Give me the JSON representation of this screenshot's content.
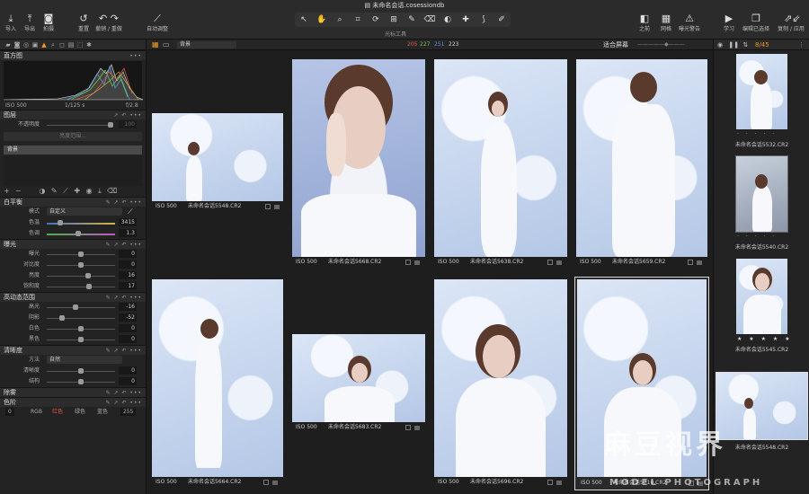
{
  "window": {
    "title": "未命名会话.cosessiondb"
  },
  "toolbar": {
    "import": "导入",
    "export": "导出",
    "capture": "拍摄",
    "reset": "重置",
    "undo_redo": "撤销 / 重做",
    "auto_adjust": "自动调整",
    "cursor_tools": "光标工具",
    "before": "之前",
    "grid": "网格",
    "exposure_warning": "曝光警告",
    "learn": "学习",
    "edit_selected": "编辑已选择",
    "copy_apply": "复制 / 应用"
  },
  "left": {
    "histogram": {
      "title": "直方图",
      "iso": "ISO 500",
      "shutter": "1/125 s",
      "aperture": "f/2.8"
    },
    "layers": {
      "title": "图层",
      "opacity_label": "不透明度",
      "opacity_value": "100",
      "brightness_range": "亮度范围...",
      "layer_name": "背景"
    },
    "white_balance": {
      "title": "白平衡",
      "mode_label": "模式",
      "mode_value": "自定义",
      "temp_label": "色温",
      "temp_value": "3415",
      "tint_label": "色调",
      "tint_value": "1.3"
    },
    "exposure": {
      "title": "曝光",
      "rows": [
        {
          "label": "曝光",
          "value": "0"
        },
        {
          "label": "对比度",
          "value": "0"
        },
        {
          "label": "亮度",
          "value": "16"
        },
        {
          "label": "饱和度",
          "value": "17"
        }
      ]
    },
    "hdr": {
      "title": "高动态范围",
      "rows": [
        {
          "label": "高光",
          "value": "-16"
        },
        {
          "label": "阴影",
          "value": "-52"
        },
        {
          "label": "白色",
          "value": "0"
        },
        {
          "label": "黑色",
          "value": "0"
        }
      ]
    },
    "clarity": {
      "title": "清晰度",
      "method_label": "方法",
      "method_value": "自然",
      "rows": [
        {
          "label": "清晰度",
          "value": "0"
        },
        {
          "label": "结构",
          "value": "0"
        }
      ]
    },
    "dehaze": {
      "title": "除雾"
    },
    "levels": {
      "title": "色阶",
      "min": "0",
      "max": "255",
      "tabs": [
        "RGB",
        "红色",
        "绿色",
        "蓝色"
      ]
    }
  },
  "center": {
    "filter_value": "背景",
    "counts": {
      "red": "205",
      "green": "227",
      "blue": "251",
      "total": "223"
    },
    "fit_label": "适合屏幕",
    "thumbs": [
      {
        "iso": "ISO 500",
        "file": "未命名会话5548.CR2"
      },
      {
        "iso": "ISO 500",
        "file": "未命名会话5668.CR2"
      },
      {
        "iso": "ISO 500",
        "file": "未命名会话5638.CR2"
      },
      {
        "iso": "ISO 500",
        "file": "未命名会话5659.CR2"
      },
      {
        "iso": "ISO 500",
        "file": "未命名会话5664.CR2"
      },
      {
        "iso": "ISO 500",
        "file": "未命名会话5683.CR2"
      },
      {
        "iso": "ISO 500",
        "file": "未命名会话5696.CR2"
      },
      {
        "iso": "ISO 500",
        "file": "未命名会话5710.CR2"
      }
    ]
  },
  "right": {
    "counter": "8/45",
    "items": [
      {
        "file": "未命名会话5532.CR2",
        "stars": "· · · · ·"
      },
      {
        "file": "未命名会话5540.CR2",
        "stars": "· · · · ·"
      },
      {
        "file": "未命名会话5545.CR2",
        "stars": "★ ★ ★ ★ ★"
      },
      {
        "file": "未命名会话5548.CR2",
        "stars": ""
      }
    ]
  },
  "watermark": {
    "line1": "麻豆视界",
    "line2": "MODEL PHOTOGRAPH"
  },
  "colors": {
    "accent": "#f29a1c",
    "count_red": "#e0584c",
    "count_green": "#7cc04a",
    "count_blue": "#5a8fe0",
    "selected_border": "#d8d8d8"
  }
}
